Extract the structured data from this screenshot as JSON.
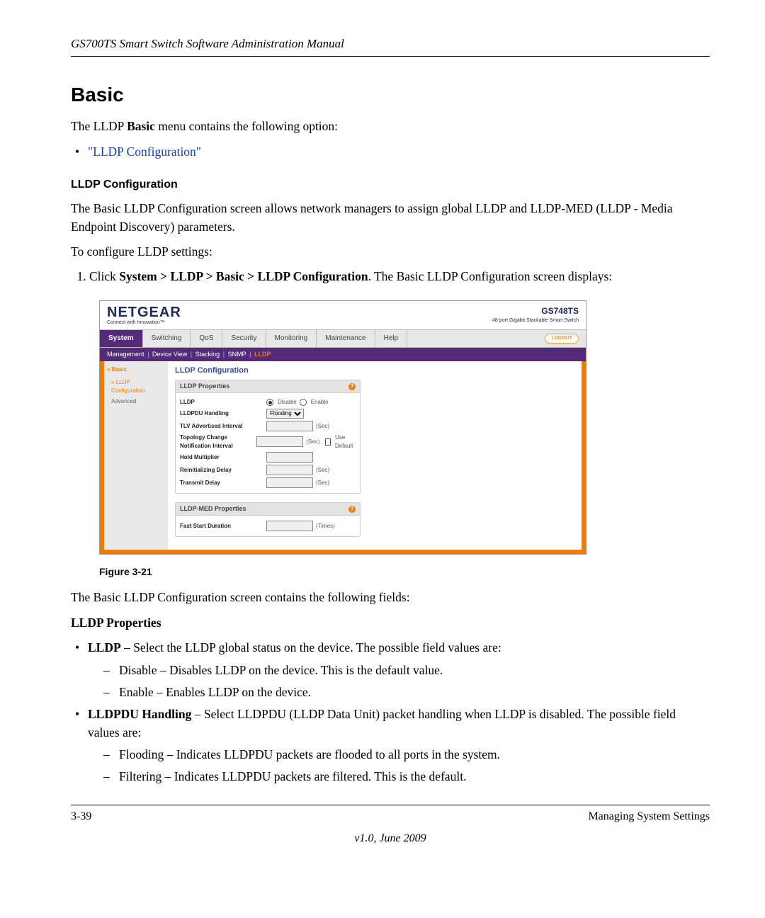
{
  "header": {
    "running_title": "GS700TS Smart Switch Software Administration Manual"
  },
  "section_heading": "Basic",
  "intro_prefix": "The LLDP ",
  "intro_bold": "Basic",
  "intro_suffix": " menu contains the following option:",
  "bullet_link": "\"LLDP Configuration\"",
  "subhead": "LLDP Configuration",
  "para1": "The Basic LLDP Configuration screen allows network managers to assign global LLDP and LLDP-MED (LLDP - Media Endpoint Discovery) parameters.",
  "para2": "To configure LLDP settings:",
  "step1_prefix": "Click ",
  "step1_bold": "System > LLDP > Basic > LLDP Configuration",
  "step1_suffix": ". The Basic LLDP Configuration screen displays:",
  "figure_caption": "Figure 3-21",
  "para3": "The Basic LLDP Configuration screen contains the following fields:",
  "props_heading": "LLDP Properties",
  "items": {
    "lldp_label": "LLDP",
    "lldp_text": " – Select the LLDP global status on the device. The possible field values are:",
    "lldp_opt1": "Disable – Disables LLDP on the device. This is the default value.",
    "lldp_opt2": "Enable – Enables LLDP on the device.",
    "handling_label": "LLDPDU Handling",
    "handling_text": " – Select LLDPDU (LLDP Data Unit) packet handling when LLDP is disabled. The possible field values are:",
    "handling_opt1": "Flooding – Indicates LLDPDU packets are flooded to all ports in the system.",
    "handling_opt2": "Filtering – Indicates LLDPDU packets are filtered. This is the default."
  },
  "footer": {
    "left": "3-39",
    "right": "Managing System Settings",
    "center": "v1.0, June 2009"
  },
  "fig": {
    "brand": "NETGEAR",
    "brand_sub": "Connect with Innovation™",
    "model": "GS748TS",
    "model_sub": "48-port Gigabit Stackable Smart Switch",
    "tabs": [
      "System",
      "Switching",
      "QoS",
      "Security",
      "Monitoring",
      "Maintenance",
      "Help"
    ],
    "active_tab": "System",
    "logout": "LOGOUT",
    "subnav": [
      "Management",
      "Device View",
      "Stacking",
      "SNMP",
      "LLDP"
    ],
    "subnav_current": "LLDP",
    "side_group": "» Basic",
    "side_items": [
      "» LLDP Configuration",
      "Advanced"
    ],
    "side_selected": "» LLDP Configuration",
    "panel_title": "LLDP Configuration",
    "panel1_hd": "LLDP Properties",
    "panel2_hd": "LLDP-MED Properties",
    "rows": {
      "lldp": "LLDP",
      "disable": "Disable",
      "enable": "Enable",
      "handling": "LLDPDU Handling",
      "handling_val": "Flooding",
      "tlv": "TLV Advertised Interval",
      "topo": "Topology Change Notification Interval",
      "hold": "Hold Multiplier",
      "reinit": "Reinitializing Delay",
      "txdelay": "Transmit Delay",
      "fast": "Fast Start Duration",
      "sec": "(Sec)",
      "times": "(Times)",
      "usedef": "Use Default"
    }
  }
}
